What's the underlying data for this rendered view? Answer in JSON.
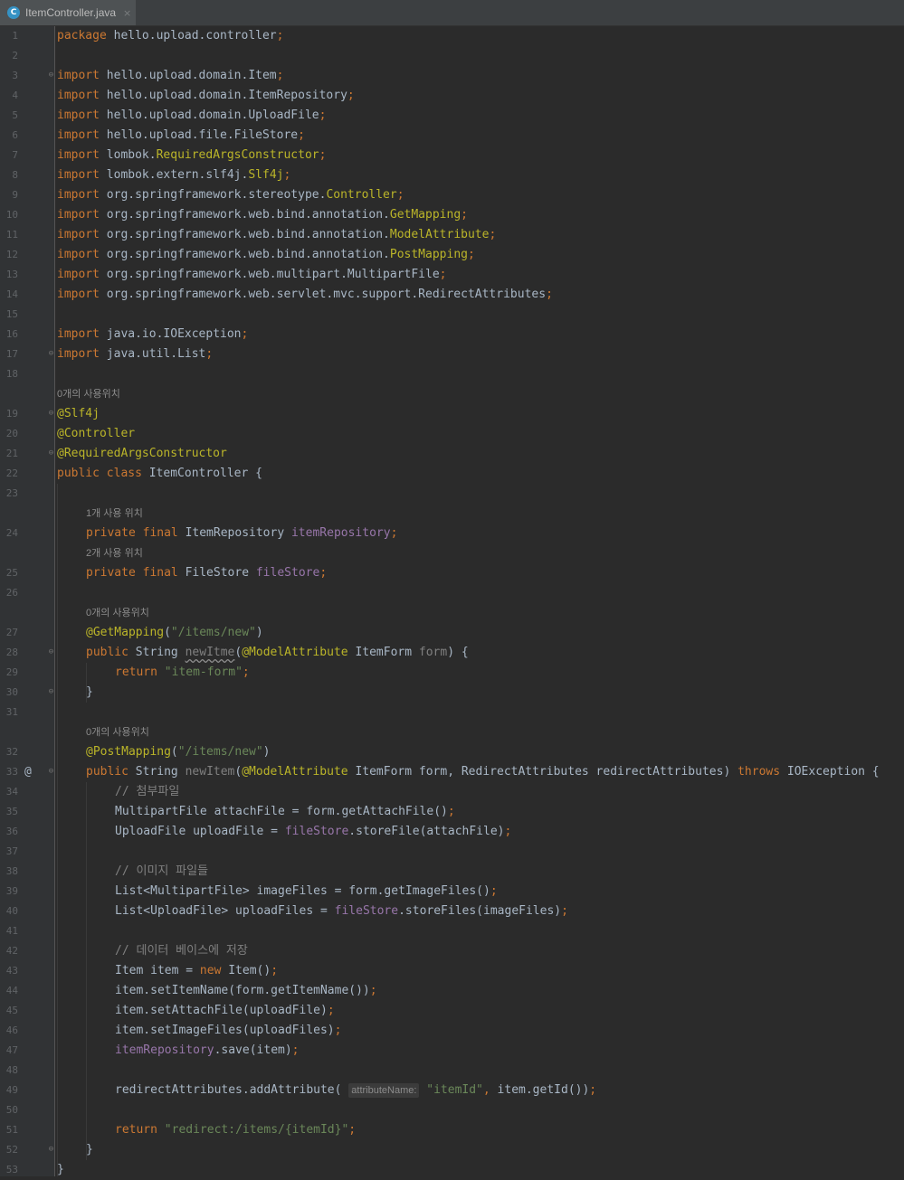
{
  "tab": {
    "title": "ItemController.java",
    "icon": "class-file-icon",
    "icon_letter": "C",
    "close": "×"
  },
  "gutter_marker": "@",
  "hints": {
    "h19": "0개의 사용위치",
    "h24": "1개 사용 위치",
    "h25": "2개 사용 위치",
    "h27": "0개의 사용위치",
    "h32": "0개의 사용위치"
  },
  "lines": {
    "l1": "package hello.upload.controller;",
    "l3": "import hello.upload.domain.Item;",
    "l4": "import hello.upload.domain.ItemRepository;",
    "l5": "import hello.upload.domain.UploadFile;",
    "l6": "import hello.upload.file.FileStore;",
    "l7": "import lombok.RequiredArgsConstructor;",
    "l8": "import lombok.extern.slf4j.Slf4j;",
    "l9": "import org.springframework.stereotype.Controller;",
    "l10": "import org.springframework.web.bind.annotation.GetMapping;",
    "l11": "import org.springframework.web.bind.annotation.ModelAttribute;",
    "l12": "import org.springframework.web.bind.annotation.PostMapping;",
    "l13": "import org.springframework.web.multipart.MultipartFile;",
    "l14": "import org.springframework.web.servlet.mvc.support.RedirectAttributes;",
    "l16": "import java.io.IOException;",
    "l17": "import java.util.List;",
    "l19": "@Slf4j",
    "l20": "@Controller",
    "l21": "@RequiredArgsConstructor",
    "l22": "public class ItemController {",
    "l24": "private final ItemRepository itemRepository;",
    "l25": "private final FileStore fileStore;",
    "l27": "@GetMapping(\"/items/new\")",
    "l28": "public String newItme(@ModelAttribute ItemForm form) {",
    "l29": "return \"item-form\";",
    "l30": "}",
    "l32": "@PostMapping(\"/items/new\")",
    "l33": "public String newItem(@ModelAttribute ItemForm form, RedirectAttributes redirectAttributes) throws IOException {",
    "l34": "// 첨부파일",
    "l35": "MultipartFile attachFile = form.getAttachFile();",
    "l36": "UploadFile uploadFile = fileStore.storeFile(attachFile);",
    "l38": "// 이미지 파일들",
    "l39": "List<MultipartFile> imageFiles = form.getImageFiles();",
    "l40": "List<UploadFile> uploadFiles = fileStore.storeFiles(imageFiles);",
    "l42": "// 데이터 베이스에 저장",
    "l43": "Item item = new Item();",
    "l44": "item.setItemName(form.getItemName());",
    "l45": "item.setAttachFile(uploadFile);",
    "l46": "item.setImageFiles(uploadFiles);",
    "l47": "itemRepository.save(item);",
    "l49_inlay": "attributeName:",
    "l49": "redirectAttributes.addAttribute(attributeName: \"itemId\", item.getId());",
    "l51": "return \"redirect:/items/{itemId}\";",
    "l52": "}",
    "l53": "}"
  },
  "colors": {
    "background": "#2b2b2b",
    "keyword": "#cc7832",
    "annotation": "#bbb529",
    "string": "#6a8759",
    "field": "#9876aa",
    "comment": "#808080",
    "text": "#a9b7c6"
  }
}
